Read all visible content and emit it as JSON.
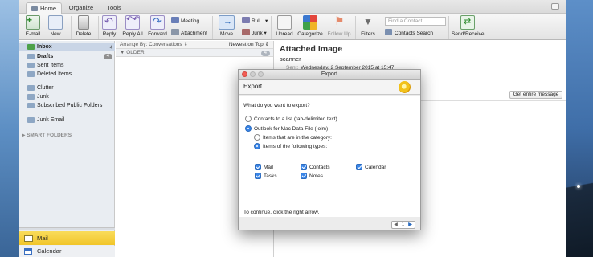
{
  "ribbon_tabs": {
    "home": "Home",
    "organize": "Organize",
    "tools": "Tools"
  },
  "ribbon": {
    "email": "E-mail",
    "new": "New",
    "delete": "Delete",
    "reply": "Reply",
    "reply_all": "Reply All",
    "forward": "Forward",
    "meeting": "Meeting",
    "attachment": "Attachment",
    "move": "Move",
    "rules": "Rul...",
    "junk": "Junk",
    "unread": "Unread",
    "categorize": "Categorize",
    "follow_up": "Follow Up",
    "filters": "Filters",
    "find_placeholder": "Find a Contact",
    "contacts_search": "Contacts Search",
    "send_receive": "Send/Receive"
  },
  "sidebar": {
    "items": [
      {
        "label": "Inbox",
        "count": "4"
      },
      {
        "label": "Drafts",
        "count": "4"
      },
      {
        "label": "Sent Items"
      },
      {
        "label": "Deleted Items"
      },
      {
        "label": "Clutter"
      },
      {
        "label": "Junk"
      },
      {
        "label": "Subscribed Public Folders"
      },
      {
        "label": "Junk Email"
      }
    ],
    "smart_folders": "SMART FOLDERS",
    "mail": "Mail",
    "calendar": "Calendar"
  },
  "message_list": {
    "arrange": "Arrange By: Conversations",
    "sort": "Newest on Top",
    "group": "OLDER",
    "group_count": "4"
  },
  "reading_pane": {
    "subject": "Attached Image",
    "sender": "scanner",
    "sent_label": "Sent:",
    "sent_value": "Wednesday, 2 September 2015 at 15:47",
    "get_entire": "Get entire message"
  },
  "export_dialog": {
    "title": "Export",
    "heading": "Export",
    "question": "What do you want to export?",
    "opt_contacts_list": "Contacts to a list (tab-delimited text)",
    "opt_olm": "Outlook for Mac Data File (.olm)",
    "opt_category": "Items that are in the category:",
    "opt_types": "Items of the following types:",
    "types": {
      "mail": "Mail",
      "contacts": "Contacts",
      "calendar": "Calendar",
      "tasks": "Tasks",
      "notes": "Notes"
    },
    "continue_text": "To continue, click the right arrow.",
    "pager_prev": "◀",
    "pager_page": "1",
    "pager_next": "▶"
  }
}
